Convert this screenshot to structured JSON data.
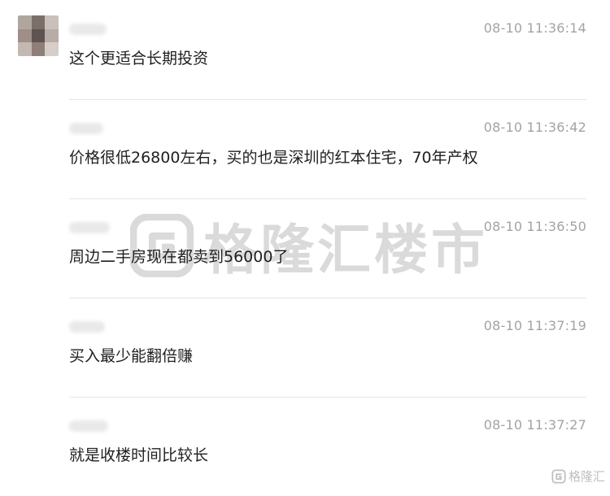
{
  "comments": [
    {
      "time": "08-10 11:36:14",
      "text": "这个更适合长期投资"
    },
    {
      "time": "08-10 11:36:42",
      "text": "价格很低26800左右，买的也是深圳的红本住宅，70年产权"
    },
    {
      "time": "08-10 11:36:50",
      "text": "周边二手房现在都卖到56000了"
    },
    {
      "time": "08-10 11:37:19",
      "text": "买入最少能翻倍赚"
    },
    {
      "time": "08-10 11:37:27",
      "text": "就是收楼时间比较长"
    }
  ],
  "watermark": {
    "text": "格隆汇楼市"
  },
  "corner_watermark": {
    "text": "格隆汇"
  },
  "colors": {
    "timestamp": "#a3a3a3",
    "divider": "#e6e6e6",
    "text": "#1f1f1f"
  }
}
